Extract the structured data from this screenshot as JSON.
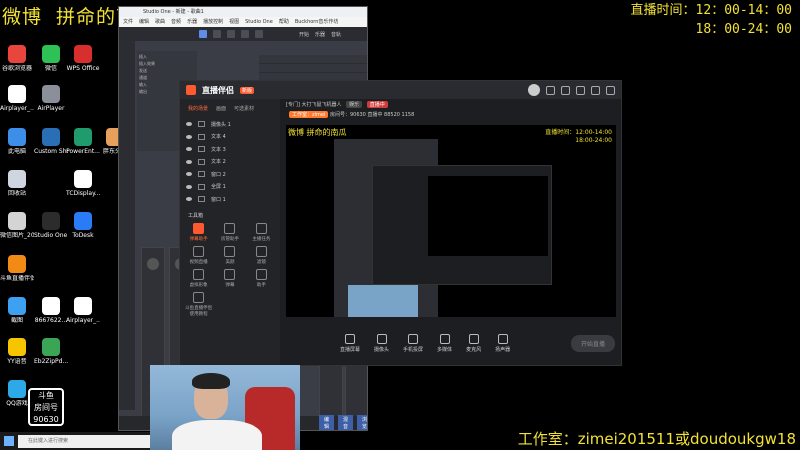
{
  "overlay": {
    "top_left_a": "微博",
    "top_left_b": "拼命的南瓜",
    "broadcast_time_line1": "直播时间：12：00-14：00",
    "broadcast_time_line2": "18：00-24：00",
    "studio_contact": "工作室：zimei201511或doudoukgw18"
  },
  "desktop_icons": [
    {
      "label": "谷歌浏览器",
      "color": "#e8453c"
    },
    {
      "label": "微信",
      "color": "#2ec256"
    },
    {
      "label": "WPS Office",
      "color": "#d92e2e"
    },
    {
      "label": "Airplayer_...",
      "color": "#ffffff"
    },
    {
      "label": "AirPlayer",
      "color": "#8a8f9a"
    },
    {
      "label": "此电脑",
      "color": "#3d8ee8"
    },
    {
      "label": "Custom Shop",
      "color": "#2a6fb5"
    },
    {
      "label": "PowerEnt...",
      "color": "#1f9b6e"
    },
    {
      "label": "胖东头像",
      "color": "#e7a05c"
    },
    {
      "label": "回收站",
      "color": "#cfd6df"
    },
    {
      "label": "TCDisplay... (1)",
      "color": "#ffffff"
    },
    {
      "label": "微信图片_2022040...",
      "color": "#d4d4d4"
    },
    {
      "label": "Studio One - 快捷方式",
      "color": "#2c2c2c"
    },
    {
      "label": "ToDesk",
      "color": "#2a7bf6"
    },
    {
      "label": "斗鱼直播伴侣",
      "color": "#f28a16"
    },
    {
      "label": "截图",
      "color": "#3da0f0"
    },
    {
      "label": "8667622...",
      "color": "#ffffff"
    },
    {
      "label": "Airplayer_...",
      "color": "#ffffff"
    },
    {
      "label": "YY语音",
      "color": "#f7c500"
    },
    {
      "label": "Eb2ZipPd...",
      "color": "#3aa655"
    },
    {
      "label": "QQ游戏",
      "color": "#2da9e8"
    }
  ],
  "watermark": {
    "line1": "斗鱼",
    "line2": "房间号",
    "line3": "90630"
  },
  "taskbar": {
    "search_placeholder": "在此键入进行搜索"
  },
  "studio": {
    "title": "Studio One - 新建 - 歌曲1",
    "menu": [
      "文件",
      "编辑",
      "歌曲",
      "音频",
      "乐器",
      "播放控制",
      "视图",
      "Studio One",
      "帮助",
      "Buckhorn音乐作坊"
    ],
    "toolbar_labels": [
      "开始",
      "乐器",
      "音轨"
    ],
    "inspector_rows": [
      "插入",
      "插入效果",
      "发送",
      "通道",
      "输入",
      "输出"
    ],
    "bottom_tabs": [
      "编辑",
      "混音",
      "浏览"
    ]
  },
  "live": {
    "brand": "直播伴侣",
    "brand_badge": "新版",
    "room_title": "[专门] 大打飞鼠飞机器人",
    "room_tags": [
      "娱乐",
      "直播中",
      "直播中 88520",
      "1158"
    ],
    "user_name": "拼命的南瓜",
    "room_meta": [
      "工作室：zimei",
      "房间号：90630",
      "粉丝"
    ],
    "sidebar_tabs": [
      "我的场景",
      "画面",
      "可选素材"
    ],
    "layers": [
      "摄像头 1",
      "文本 4",
      "文本 3",
      "文本 2",
      "窗口 2",
      "全屏 1",
      "窗口 1"
    ],
    "tools_title": "工具箱",
    "tools": [
      {
        "label": "弹幕助手",
        "hot": true
      },
      {
        "label": "房管助手",
        "hot": false
      },
      {
        "label": "主播任务",
        "hot": false
      },
      {
        "label": "视频直播",
        "hot": false
      },
      {
        "label": "美颜",
        "hot": false
      },
      {
        "label": "滤镜",
        "hot": false
      },
      {
        "label": "虚拟形象",
        "hot": false
      },
      {
        "label": "弹幕",
        "hot": false
      },
      {
        "label": "助手",
        "hot": false
      },
      {
        "label": "斗鱼直播伴侣使用教程",
        "hot": false
      }
    ],
    "preview_title": "微博 拼命的南瓜",
    "preview_time_1": "直播时间：12:00-14:00",
    "preview_time_2": "18:00-24:00",
    "bottom_controls": [
      "直播屏幕",
      "摄像头",
      "手机投屏",
      "多媒体",
      "麦克风",
      "扬声器"
    ],
    "start_button": "开始直播"
  },
  "colors": {
    "overlay_text": "#f2e233",
    "brand_accent": "#ff5a2f"
  }
}
